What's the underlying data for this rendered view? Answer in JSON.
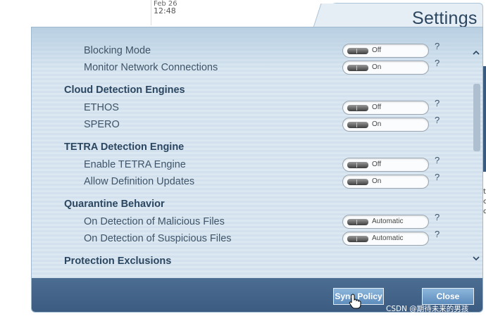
{
  "background": {
    "date_fragment": "Feb 26",
    "time": "12:48",
    "side_text": [
      "t",
      "c",
      "d"
    ]
  },
  "dialog": {
    "title": "Settings",
    "rows": [
      {
        "label": "Blocking Mode",
        "value": "Off"
      },
      {
        "label": "Monitor Network Connections",
        "value": "On"
      }
    ],
    "sections": [
      {
        "title": "Cloud Detection Engines",
        "rows": [
          {
            "label": "ETHOS",
            "value": "Off"
          },
          {
            "label": "SPERO",
            "value": "On"
          }
        ]
      },
      {
        "title": "TETRA Detection Engine",
        "rows": [
          {
            "label": "Enable TETRA Engine",
            "value": "Off"
          },
          {
            "label": "Allow Definition Updates",
            "value": "On"
          }
        ]
      },
      {
        "title": "Quarantine Behavior",
        "rows": [
          {
            "label": "On Detection of Malicious Files",
            "value": "Automatic"
          },
          {
            "label": "On Detection of Suspicious Files",
            "value": "Automatic"
          }
        ]
      },
      {
        "title": "Protection Exclusions",
        "rows": []
      }
    ],
    "help_symbol": "?",
    "scroll_up_symbol": "^",
    "scroll_down_symbol": "v",
    "buttons": {
      "sync": "Sync Policy",
      "close": "Close"
    }
  },
  "watermark": "CSDN @期待未来的男孩",
  "icons": {
    "scroll_up": "chevron-up-icon",
    "scroll_down": "chevron-down-icon",
    "cursor": "hand-pointer-icon"
  }
}
